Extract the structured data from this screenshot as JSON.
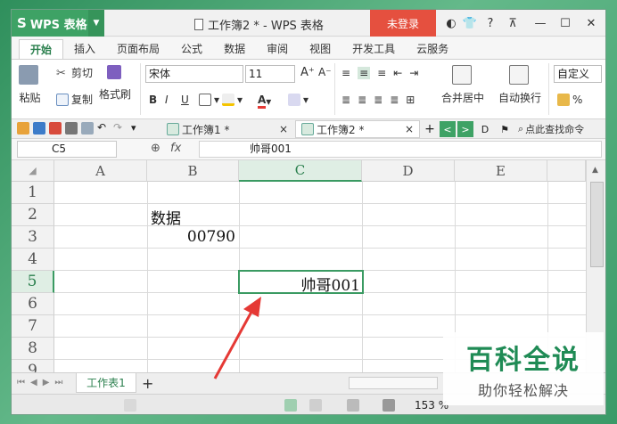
{
  "app": {
    "name": "WPS 表格",
    "window_title": "工作簿2 * - WPS 表格",
    "login": "未登录"
  },
  "ribbon_tabs": [
    "开始",
    "插入",
    "页面布局",
    "公式",
    "数据",
    "审阅",
    "视图",
    "开发工具",
    "云服务"
  ],
  "ribbon": {
    "paste": "粘贴",
    "cut": "剪切",
    "copy": "复制",
    "format_painter": "格式刷",
    "font_name": "宋体",
    "font_size": "11",
    "merge_center": "合并居中",
    "auto_wrap": "自动换行",
    "number_format": "自定义",
    "percent": "%"
  },
  "doc_tabs": [
    "工作簿1 *",
    "工作簿2 *"
  ],
  "search_text": "点此查找命令",
  "formula_bar": {
    "name_box": "C5",
    "fx": "fx",
    "content": "帅哥001"
  },
  "columns": [
    "A",
    "B",
    "C",
    "D",
    "E"
  ],
  "rows": [
    "1",
    "2",
    "3",
    "4",
    "5",
    "6",
    "7",
    "8",
    "9"
  ],
  "cells": {
    "B2": "数据",
    "B3": "00790",
    "C5": "帅哥001"
  },
  "selected_cell": "C5",
  "sheet_tabs": [
    "工作表1"
  ],
  "status": {
    "zoom": "153 %"
  },
  "watermark": {
    "title": "百科全说",
    "subtitle": "助你轻松解决"
  },
  "colors": {
    "accent": "#3ea265",
    "login": "#e5503f",
    "selection": "#3a9a62",
    "arrow": "#e53935"
  }
}
